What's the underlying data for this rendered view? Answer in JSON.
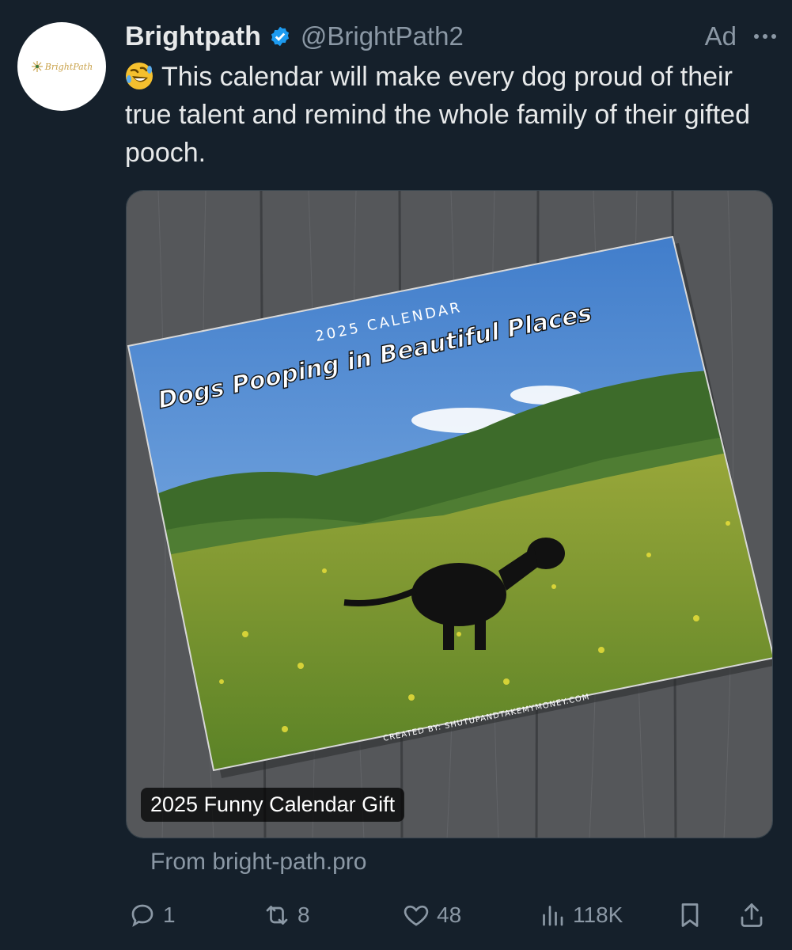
{
  "author": {
    "display_name": "Brightpath",
    "handle": "@BrightPath2",
    "avatar_text": "BrightPath"
  },
  "ad_label": "Ad",
  "tweet": {
    "emoji": "rolling-on-floor-laughing",
    "text": "This calendar will make every dog proud of their true talent and remind the whole family of their gifted pooch."
  },
  "media": {
    "calendar_year_line": "2025 CALENDAR",
    "calendar_title": "Dogs Pooping in Beautiful Places",
    "calendar_credit": "CREATED BY: SHUTUPANDTAKEMYMONEY.COM",
    "caption": "2025 Funny Calendar Gift"
  },
  "source": "From bright-path.pro",
  "actions": {
    "replies": "1",
    "reposts": "8",
    "likes": "48",
    "views": "118K"
  },
  "colors": {
    "background": "#15202b",
    "text_primary": "#e7e9ea",
    "text_secondary": "#8b98a5",
    "verified": "#1d9bf0"
  }
}
